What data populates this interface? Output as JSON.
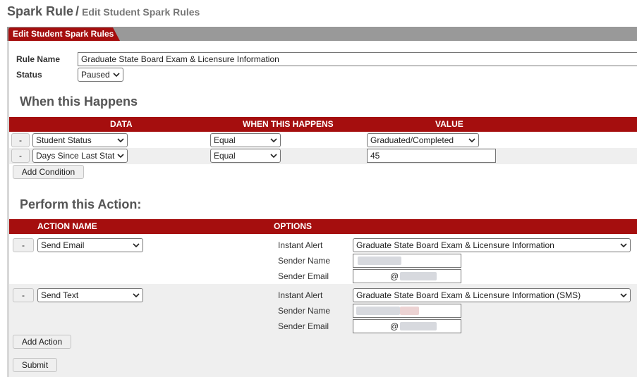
{
  "breadcrumb": {
    "main": "Spark Rule",
    "separator": "/",
    "sub": "Edit Student Spark Rules"
  },
  "panel": {
    "tab": "Edit Student Spark Rules"
  },
  "form": {
    "rule_name_label": "Rule Name",
    "rule_name_value": "Graduate State Board Exam & Licensure Information",
    "status_label": "Status",
    "status_value": "Paused"
  },
  "conditions": {
    "title": "When this Happens",
    "headers": {
      "data": "DATA",
      "when": "WHEN THIS HAPPENS",
      "value": "VALUE"
    },
    "rows": [
      {
        "remove": "-",
        "data": "Student Status",
        "operator": "Equal",
        "value": "Graduated/Completed",
        "value_type": "select"
      },
      {
        "remove": "-",
        "data": "Days Since Last Stat",
        "operator": "Equal",
        "value": "45",
        "value_type": "input"
      }
    ],
    "add_button": "Add Condition"
  },
  "actions": {
    "title": "Perform this Action:",
    "headers": {
      "name": "ACTION NAME",
      "options": "OPTIONS"
    },
    "rows": [
      {
        "remove": "-",
        "action": "Send Email",
        "instant_alert_label": "Instant Alert",
        "instant_alert": "Graduate State Board Exam & Licensure Information",
        "sender_name_label": "Sender Name",
        "sender_email_label": "Sender Email",
        "sender_email_at": "@"
      },
      {
        "remove": "-",
        "action": "Send Text",
        "instant_alert_label": "Instant Alert",
        "instant_alert": "Graduate State Board Exam & Licensure Information (SMS)",
        "sender_name_label": "Sender Name",
        "sender_email_label": "Sender Email",
        "sender_email_at": "@"
      }
    ],
    "add_button": "Add Action"
  },
  "submit_button": "Submit",
  "colors": {
    "brand": "#a50e0e",
    "panel_gray": "#999999",
    "row_gray": "#efefef"
  },
  "icons": {
    "dropdown": "chevron-down-icon"
  }
}
